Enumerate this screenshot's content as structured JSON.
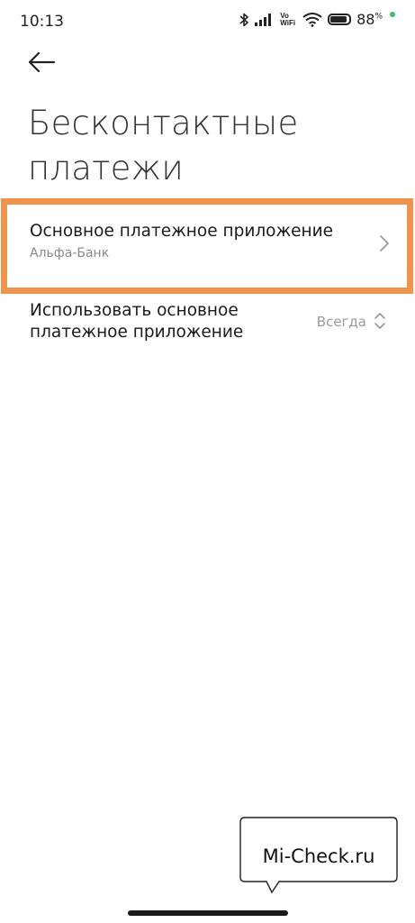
{
  "status_bar": {
    "time": "10:13",
    "vo_label": "Vo",
    "wifi_label": "WiFi",
    "battery_percent": "88",
    "battery_unit": "%",
    "battery_level": 0.88,
    "dot_color": "#38c172"
  },
  "header": {
    "back_icon": "arrow-left-icon",
    "title": "Бесконтактные платежи"
  },
  "settings": {
    "default_app": {
      "label": "Основное платежное приложение",
      "value": "Альфа-Банк"
    },
    "use_default": {
      "label": "Использовать основное платежное приложение",
      "value": "Всегда"
    }
  },
  "highlight_color": "#f0944d",
  "watermark": {
    "text": "Mi-Check.ru"
  }
}
